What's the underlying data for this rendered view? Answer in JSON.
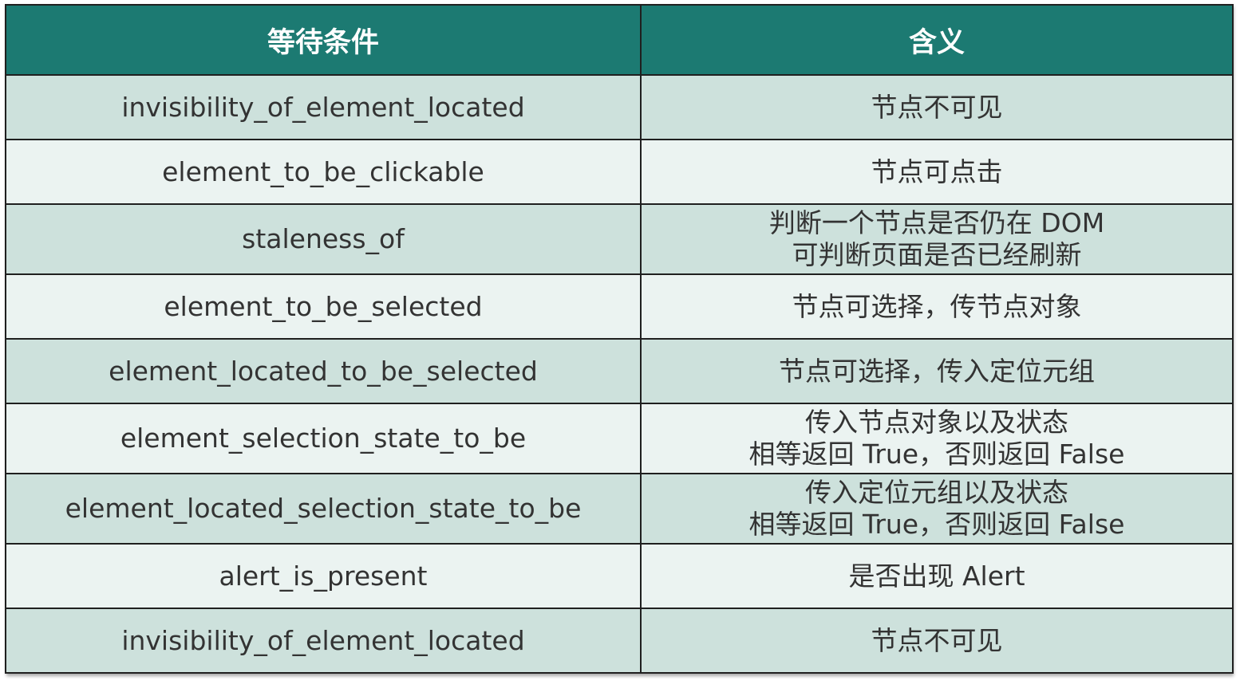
{
  "headers": {
    "condition": "等待条件",
    "meaning": "含义"
  },
  "rows": [
    {
      "condition": "invisibility_of_element_located",
      "meaning": [
        "节点不可见"
      ]
    },
    {
      "condition": "element_to_be_clickable",
      "meaning": [
        "节点可点击"
      ]
    },
    {
      "condition": "staleness_of",
      "meaning": [
        "判断一个节点是否仍在 DOM",
        "可判断页面是否已经刷新"
      ]
    },
    {
      "condition": "element_to_be_selected",
      "meaning": [
        "节点可选择，传节点对象"
      ]
    },
    {
      "condition": "element_located_to_be_selected",
      "meaning": [
        "节点可选择，传入定位元组"
      ]
    },
    {
      "condition": "element_selection_state_to_be",
      "meaning": [
        "传入节点对象以及状态",
        "相等返回 True，否则返回 False"
      ]
    },
    {
      "condition": "element_located_selection_state_to_be",
      "meaning": [
        "传入定位元组以及状态",
        "相等返回 True，否则返回 False"
      ]
    },
    {
      "condition": "alert_is_present",
      "meaning": [
        "是否出现 Alert"
      ]
    },
    {
      "condition": "invisibility_of_element_located",
      "meaning": [
        "节点不可见"
      ]
    }
  ],
  "colors": {
    "header_bg": "#1c7a72",
    "row_odd_bg": "#cde1dc",
    "row_even_bg": "#ebf3f1"
  }
}
